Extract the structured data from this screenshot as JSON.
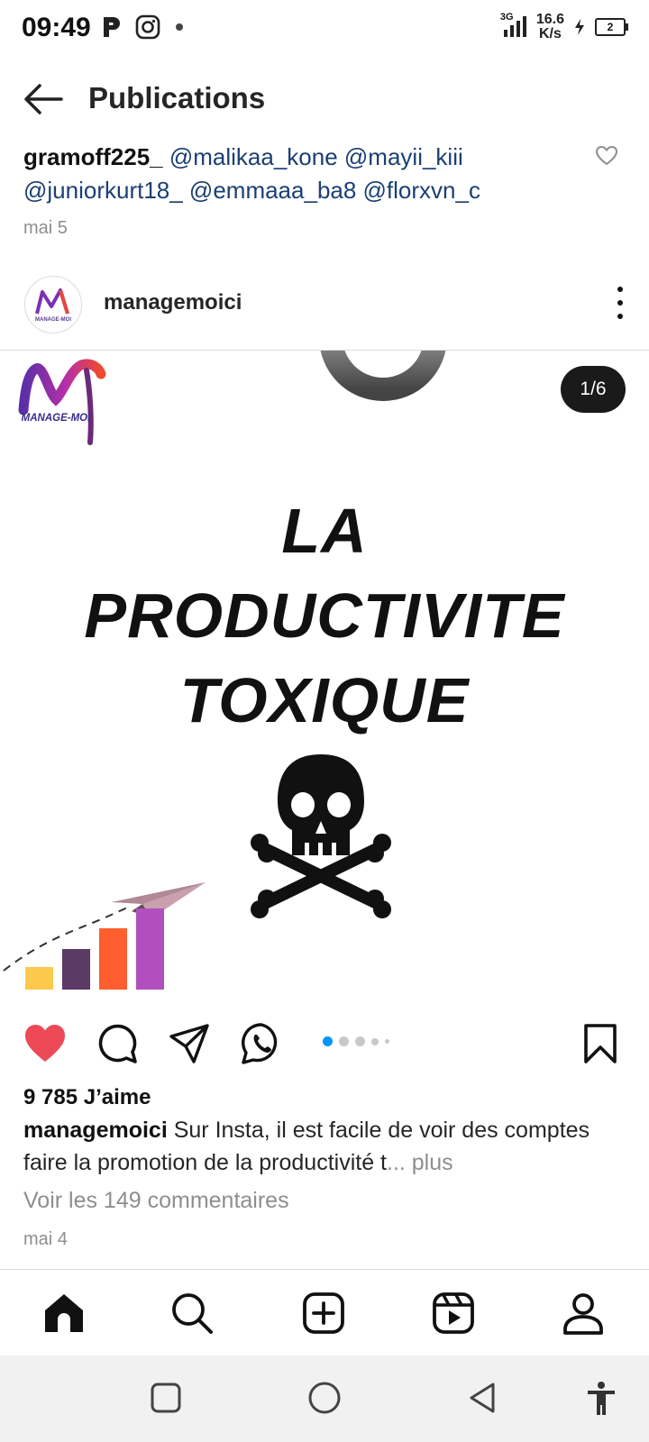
{
  "status_bar": {
    "time": "09:49",
    "left_icons": [
      "p-icon",
      "instagram-icon",
      "dot"
    ],
    "network_type": "3G",
    "net_speed_value": "16.6",
    "net_speed_unit": "K/s",
    "battery": "2"
  },
  "header": {
    "title": "Publications"
  },
  "previous_post": {
    "username": "gramoff225_",
    "mentions_line1": "@malikaa_kone @mayii_kiii",
    "mentions_line2": "@juniorkurt18_ @emmaaa_ba8 @florxvn_c",
    "date": "mai 5"
  },
  "post": {
    "username": "managemoici",
    "counter": "1/6",
    "image": {
      "logo_text": "MANAGE-MOI",
      "avatar_logo_text": "MANAGE-MOI",
      "line1": "LA",
      "line2": "PRODUCTIVITE",
      "line3": "TOXIQUE"
    },
    "likes": "9 785 J’aime",
    "caption_user": "managemoici",
    "caption_text": " Sur Insta, il est facile de voir des comptes faire la promotion de la productivité t",
    "caption_more": "... plus",
    "comments_link": "Voir les 149 commentaires",
    "date": "mai 4"
  },
  "colors": {
    "like_red": "#ed4956",
    "mention_blue": "#1b3f73",
    "active_dot": "#0095f6",
    "bar_yellow": "#fdc94d",
    "bar_purple_dark": "#5b3a66",
    "bar_orange": "#ff5e2f",
    "bar_purple": "#b24fbf"
  },
  "nav": [
    "home-icon",
    "search-icon",
    "create-icon",
    "reels-icon",
    "profile-icon"
  ]
}
